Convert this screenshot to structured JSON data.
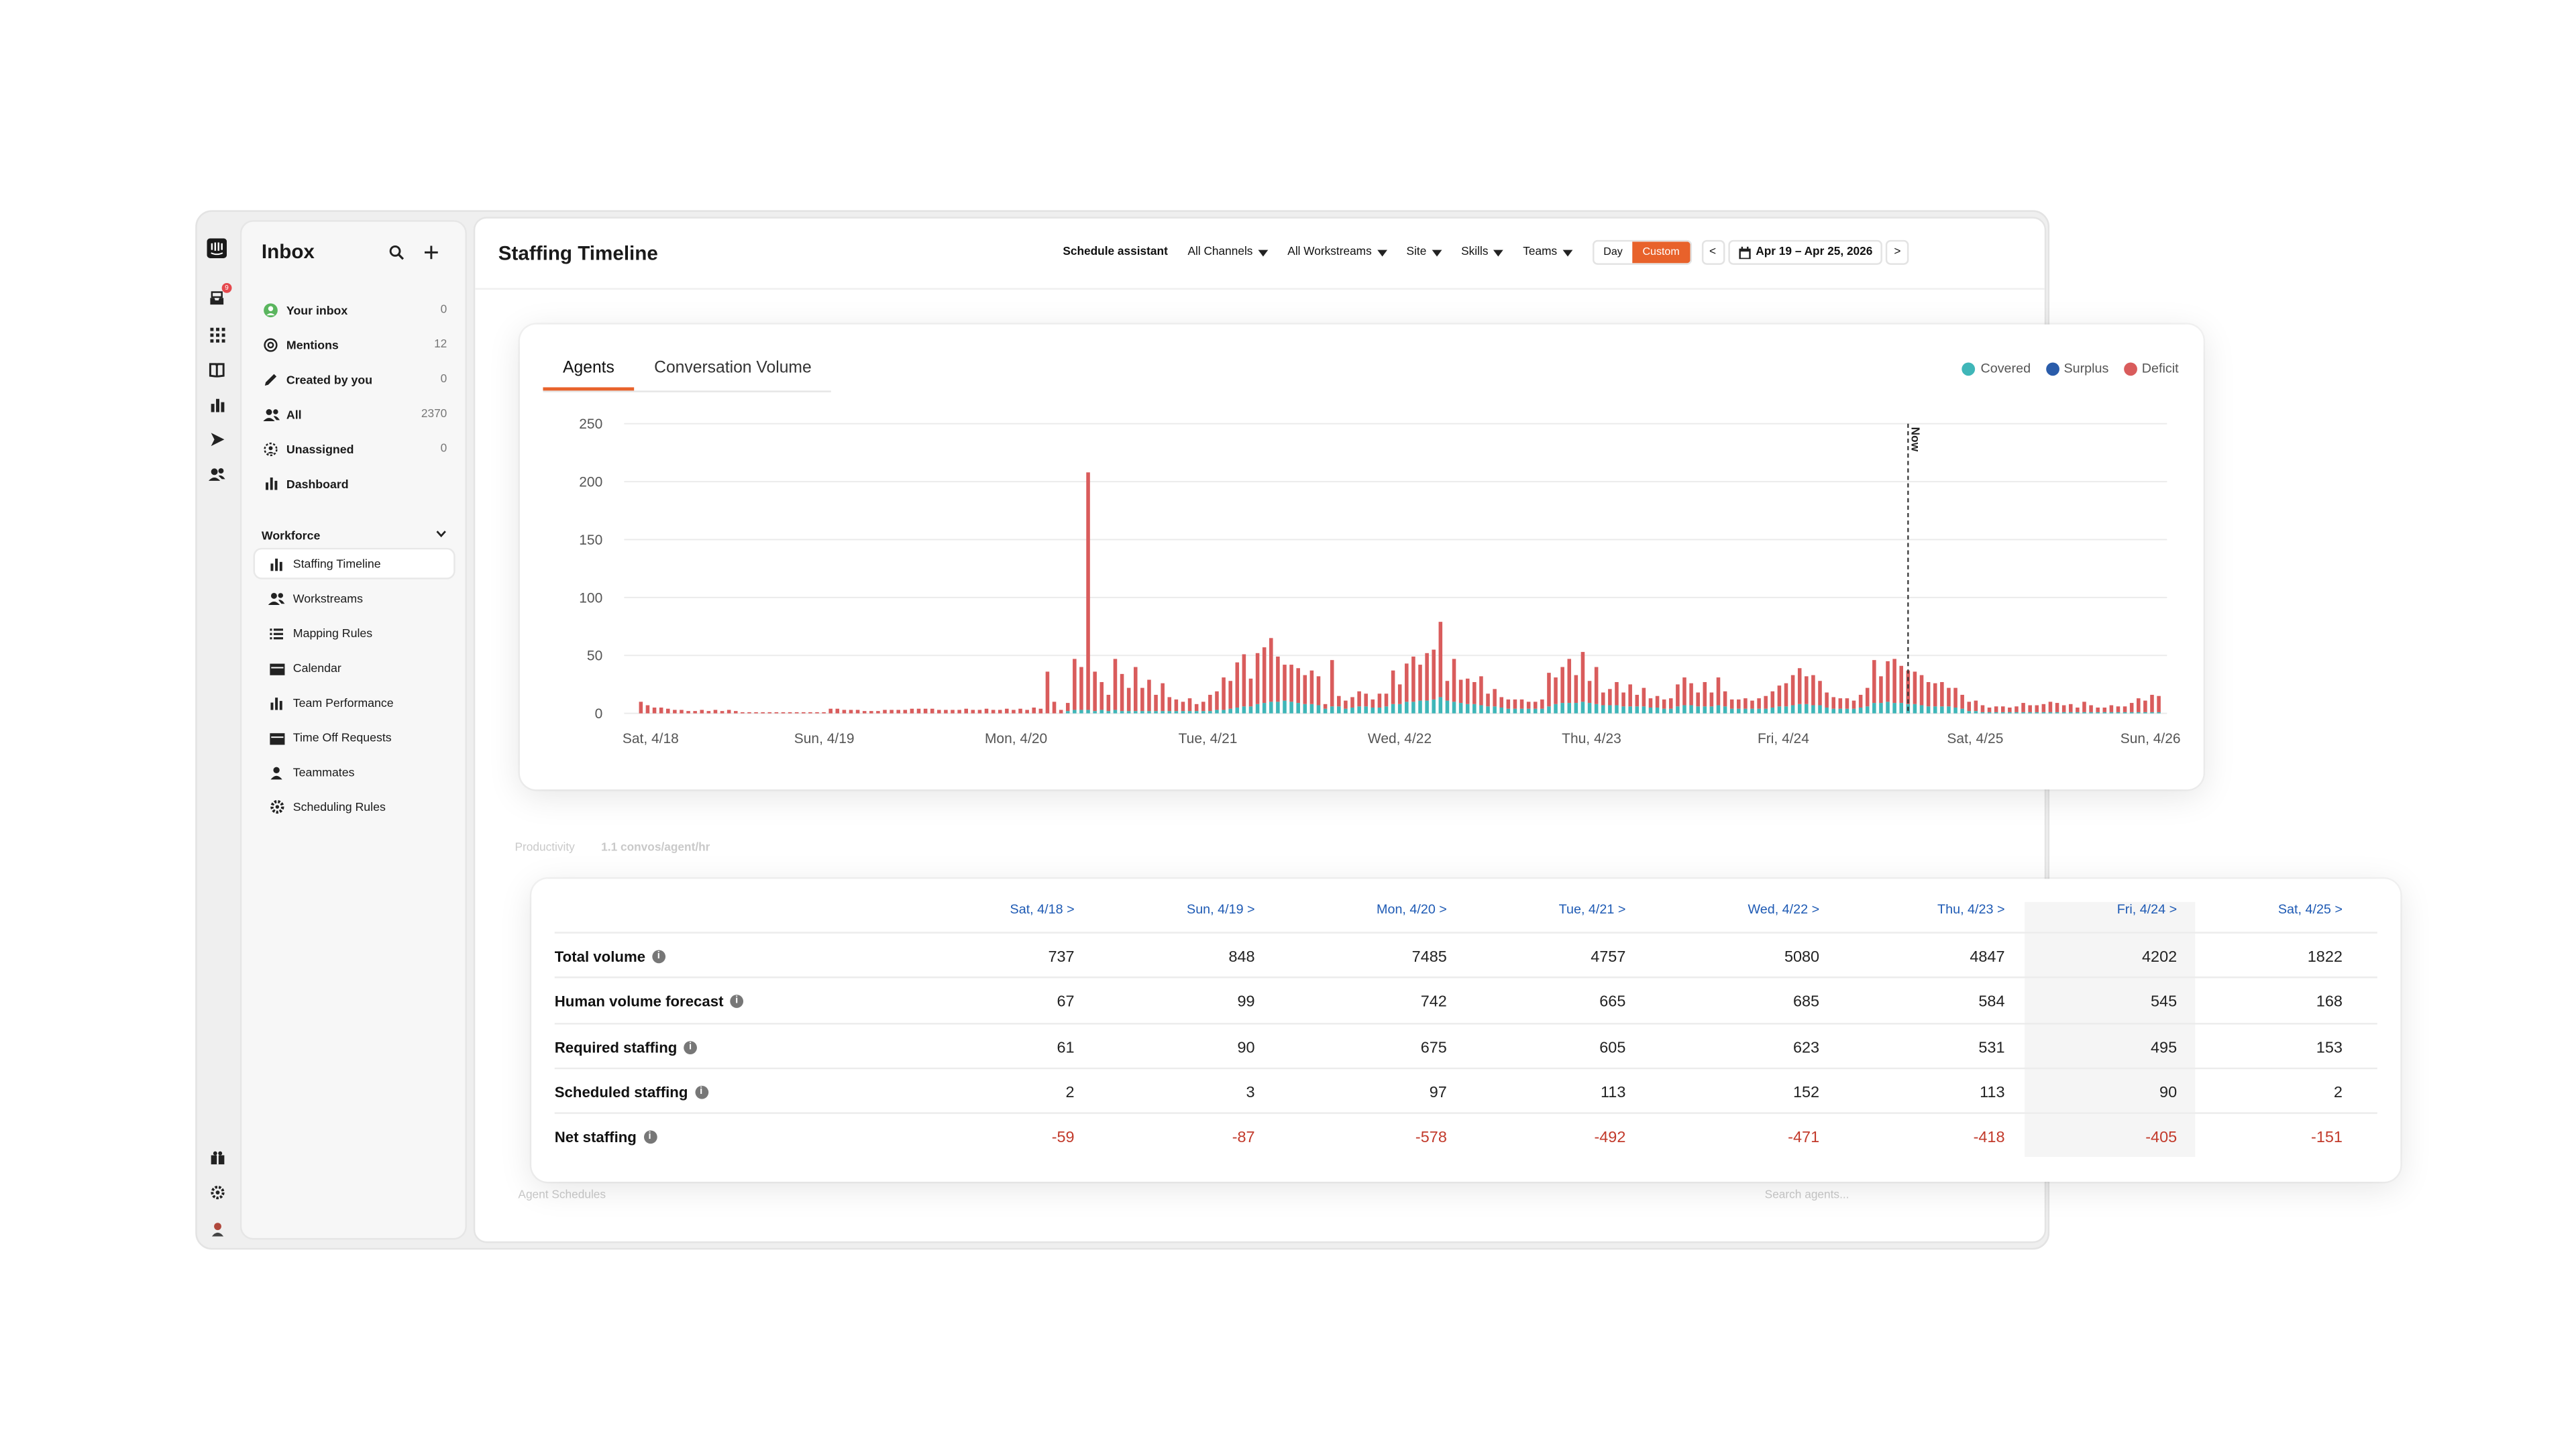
{
  "sidebar_rail": {
    "icons": [
      "intercom-logo-icon",
      "inbox-icon",
      "apps-grid-icon",
      "book-icon",
      "reports-icon",
      "send-icon",
      "contacts-icon"
    ],
    "bottom_icons": [
      "gift-icon",
      "settings-icon",
      "user-avatar-icon"
    ],
    "notification_count": "9"
  },
  "inbox": {
    "title": "Inbox",
    "items": [
      {
        "label": "Your inbox",
        "count": "0",
        "icon": "avatar-icon"
      },
      {
        "label": "Mentions",
        "count": "12",
        "icon": "at-icon"
      },
      {
        "label": "Created by you",
        "count": "0",
        "icon": "pencil-icon"
      },
      {
        "label": "All",
        "count": "2370",
        "icon": "people-icon"
      },
      {
        "label": "Unassigned",
        "count": "0",
        "icon": "unassigned-icon"
      },
      {
        "label": "Dashboard",
        "count": "",
        "icon": "bar-chart-icon"
      }
    ],
    "workforce": {
      "title": "Workforce",
      "items": [
        {
          "label": "Staffing Timeline",
          "icon": "bar-chart-icon",
          "active": true
        },
        {
          "label": "Workstreams",
          "icon": "people-icon"
        },
        {
          "label": "Mapping Rules",
          "icon": "list-icon"
        },
        {
          "label": "Calendar",
          "icon": "calendar-icon"
        },
        {
          "label": "Team Performance",
          "icon": "bar-chart-icon"
        },
        {
          "label": "Time Off Requests",
          "icon": "calendar-icon"
        },
        {
          "label": "Teammates",
          "icon": "person-icon"
        },
        {
          "label": "Scheduling Rules",
          "icon": "gear-icon"
        }
      ]
    }
  },
  "header": {
    "title": "Staffing Timeline",
    "schedule_assistant": "Schedule assistant",
    "filters": [
      "All Channels",
      "All Workstreams",
      "Site",
      "Skills",
      "Teams"
    ],
    "view_day": "Day",
    "view_custom": "Custom",
    "prev": "<",
    "next": ">",
    "date_range": "Apr 19 – Apr 25, 2026"
  },
  "background_text": {
    "productivity": "Productivity",
    "productivity_value": "1.1 convos/agent/hr",
    "agent_schedules": "Agent Schedules",
    "search_agents": "Search agents..."
  },
  "chart_tabs": [
    "Agents",
    "Conversation Volume"
  ],
  "legend": [
    {
      "label": "Covered",
      "color": "#3fb6b8"
    },
    {
      "label": "Surplus",
      "color": "#2a5caa"
    },
    {
      "label": "Deficit",
      "color": "#d95c5c"
    }
  ],
  "chart_data": {
    "type": "bar",
    "stacked": true,
    "y_ticks": [
      "0",
      "50",
      "100",
      "150",
      "200",
      "250"
    ],
    "ylim": [
      0,
      250
    ],
    "x_ticks": [
      "Sat, 4/18",
      "Sun, 4/19",
      "Mon, 4/20",
      "Tue, 4/21",
      "Wed, 4/22",
      "Thu, 4/23",
      "Fri, 4/24",
      "Sat, 4/25",
      "Sun, 4/26"
    ],
    "now_label": "Now",
    "now_index": 187,
    "bars_per_day": 24,
    "series": [
      {
        "name": "Deficit",
        "values": [
          10,
          7,
          5,
          5,
          4,
          3,
          3,
          2,
          2,
          3,
          2,
          3,
          2,
          3,
          2,
          1,
          1,
          1,
          1,
          1,
          1,
          1,
          1,
          1,
          1,
          1,
          1,
          1,
          4,
          4,
          3,
          3,
          3,
          2,
          2,
          2,
          3,
          3,
          3,
          3,
          4,
          4,
          4,
          4,
          3,
          3,
          3,
          3,
          4,
          3,
          3,
          4,
          3,
          3,
          4,
          3,
          4,
          3,
          5,
          4,
          36,
          10,
          3,
          7,
          44,
          37,
          205,
          34,
          24,
          14,
          44,
          32,
          20,
          38,
          20,
          27,
          14,
          24,
          12,
          10,
          8,
          11,
          6,
          8,
          14,
          16,
          28,
          24,
          39,
          45,
          24,
          44,
          48,
          55,
          39,
          31,
          32,
          30,
          25,
          29,
          25,
          4,
          40,
          9,
          7,
          9,
          13,
          11,
          7,
          12,
          11,
          29,
          17,
          33,
          39,
          31,
          41,
          43,
          65,
          17,
          37,
          20,
          22,
          19,
          25,
          11,
          15,
          9,
          8,
          8,
          8,
          6,
          6,
          8,
          29,
          23,
          31,
          38,
          24,
          43,
          19,
          32,
          11,
          14,
          20,
          12,
          19,
          10,
          16,
          8,
          10,
          8,
          9,
          19,
          24,
          19,
          12,
          21,
          12,
          24,
          13,
          8,
          8,
          9,
          7,
          9,
          11,
          14,
          18,
          20,
          26,
          31,
          24,
          26,
          21,
          13,
          10,
          9,
          9,
          7,
          11,
          16,
          37,
          23,
          35,
          38,
          32,
          29,
          28,
          26,
          21,
          20,
          21,
          16,
          17,
          12,
          8,
          9,
          6,
          4,
          5,
          5,
          4,
          5,
          8,
          6,
          6,
          7,
          9,
          8,
          6,
          7,
          4,
          9,
          6,
          4,
          4,
          6,
          5,
          5,
          8,
          12,
          10,
          15,
          14
        ]
      },
      {
        "name": "Covered",
        "values": [
          0,
          0,
          0,
          0,
          0,
          0,
          0,
          0,
          0,
          0,
          0,
          0,
          0,
          0,
          0,
          0,
          0,
          0,
          0,
          0,
          0,
          0,
          0,
          0,
          0,
          0,
          0,
          0,
          0,
          0,
          0,
          0,
          0,
          0,
          0,
          0,
          0,
          0,
          0,
          0,
          0,
          0,
          0,
          0,
          0,
          0,
          0,
          0,
          0,
          0,
          0,
          0,
          0,
          0,
          0,
          0,
          0,
          0,
          0,
          0,
          0,
          0,
          0,
          2,
          3,
          3,
          3,
          2,
          3,
          2,
          3,
          2,
          2,
          2,
          2,
          2,
          2,
          2,
          2,
          2,
          2,
          2,
          2,
          2,
          2,
          3,
          3,
          4,
          5,
          6,
          6,
          8,
          9,
          10,
          10,
          11,
          10,
          9,
          8,
          8,
          7,
          4,
          6,
          6,
          4,
          5,
          6,
          6,
          5,
          5,
          6,
          8,
          8,
          10,
          10,
          11,
          11,
          12,
          14,
          11,
          10,
          9,
          8,
          8,
          7,
          6,
          6,
          5,
          4,
          4,
          4,
          4,
          4,
          4,
          6,
          8,
          9,
          9,
          9,
          10,
          9,
          8,
          7,
          7,
          7,
          6,
          6,
          6,
          6,
          5,
          5,
          4,
          4,
          6,
          7,
          7,
          6,
          6,
          6,
          7,
          6,
          4,
          4,
          4,
          4,
          4,
          4,
          5,
          6,
          6,
          7,
          8,
          8,
          7,
          7,
          5,
          4,
          4,
          4,
          4,
          5,
          6,
          9,
          9,
          10,
          9,
          9,
          8,
          8,
          7,
          6,
          6,
          6,
          6,
          5,
          4,
          2,
          2,
          1,
          1,
          1,
          1,
          1,
          1,
          1,
          1,
          1,
          1,
          1,
          1,
          1,
          1,
          1,
          1,
          1,
          1,
          1,
          1,
          1,
          1,
          1,
          1,
          1,
          1,
          1
        ]
      }
    ]
  },
  "table": {
    "columns": [
      "Sat, 4/18 >",
      "Sun, 4/19 >",
      "Mon, 4/20 >",
      "Tue, 4/21 >",
      "Wed, 4/22 >",
      "Thu, 4/23 >",
      "Fri, 4/24 >",
      "Sat, 4/25 >"
    ],
    "rows": [
      {
        "label": "Total volume",
        "values": [
          "737",
          "848",
          "7485",
          "4757",
          "5080",
          "4847",
          "4202",
          "1822"
        ],
        "negative": false
      },
      {
        "label": "Human volume forecast",
        "values": [
          "67",
          "99",
          "742",
          "665",
          "685",
          "584",
          "545",
          "168"
        ],
        "negative": false
      },
      {
        "label": "Required staffing",
        "values": [
          "61",
          "90",
          "675",
          "605",
          "623",
          "531",
          "495",
          "153"
        ],
        "negative": false
      },
      {
        "label": "Scheduled staffing",
        "values": [
          "2",
          "3",
          "97",
          "113",
          "152",
          "113",
          "90",
          "2"
        ],
        "negative": false
      },
      {
        "label": "Net staffing",
        "values": [
          "-59",
          "-87",
          "-578",
          "-492",
          "-471",
          "-418",
          "-405",
          "-151"
        ],
        "negative": true
      }
    ]
  }
}
